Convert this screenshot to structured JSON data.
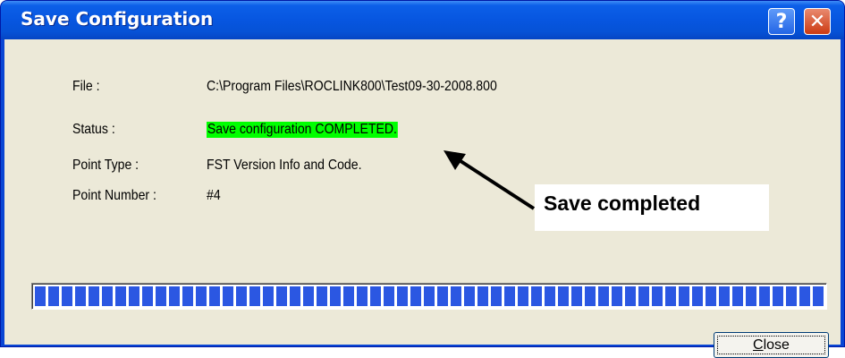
{
  "window": {
    "title": "Save Configuration",
    "help_glyph": "?",
    "close_glyph": "✕"
  },
  "fields": {
    "file_label": "File :",
    "file_value": "C:\\Program Files\\ROCLINK800\\Test09-30-2008.800",
    "status_label": "Status :",
    "status_value": "Save configuration COMPLETED.",
    "point_type_label": "Point Type :",
    "point_type_value": "FST Version Info and Code.",
    "point_number_label": "Point Number :",
    "point_number_value": "#4"
  },
  "annotation": {
    "text": "Save completed"
  },
  "progress": {
    "fraction": 1.0
  },
  "buttons": {
    "close_mnemonic": "C",
    "close_rest": "lose"
  },
  "colors": {
    "status_highlight": "#00ff00",
    "progress_block": "#2b57e2",
    "title_bar": "#0756e0"
  },
  "icons": {
    "help": "help-icon",
    "close": "close-icon",
    "arrow": "annotation-arrow"
  }
}
